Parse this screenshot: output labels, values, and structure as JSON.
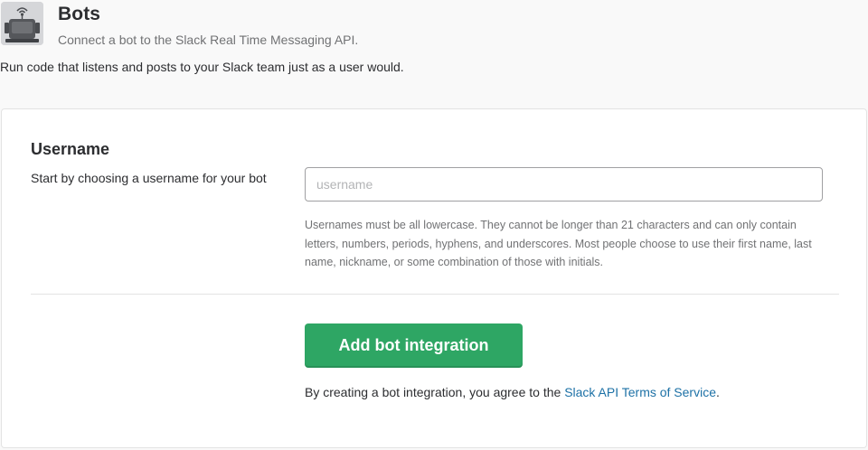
{
  "header": {
    "icon": "bot-icon",
    "title": "Bots",
    "subtitle": "Connect a bot to the Slack Real Time Messaging API."
  },
  "description": "Run code that listens and posts to your Slack team just as a user would.",
  "username_section": {
    "heading": "Username",
    "help_text": "Start by choosing a username for your bot",
    "input": {
      "value": "",
      "placeholder": "username"
    },
    "hint": "Usernames must be all lowercase. They cannot be longer than 21 characters and can only contain letters, numbers, periods, hyphens, and underscores. Most people choose to use their first name, last name, nickname, or some combination of those with initials."
  },
  "actions": {
    "add_button_label": "Add bot integration",
    "terms_prefix": "By creating a bot integration, you agree to the ",
    "terms_link_label": "Slack API Terms of Service",
    "terms_suffix": "."
  },
  "colors": {
    "button": "#2ea664",
    "link": "#1d71a6",
    "muted_text": "#717274",
    "border": "#e3e3e3"
  }
}
